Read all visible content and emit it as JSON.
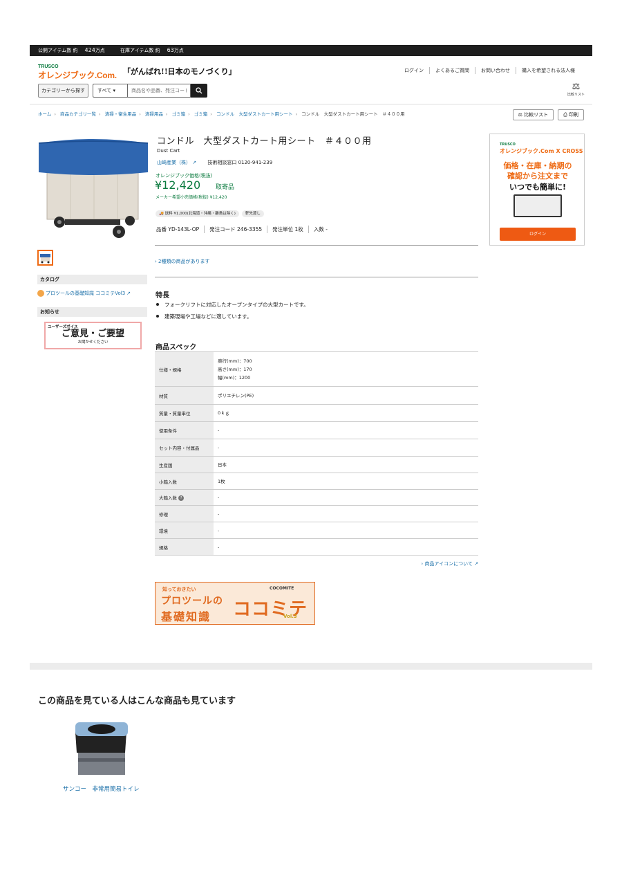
{
  "topbar": {
    "public_label": "公開アイテム数 約",
    "public_count": "424",
    "public_unit": "万点",
    "stock_label": "在庫アイテム数 約",
    "stock_count": "63",
    "stock_unit": "万点"
  },
  "header": {
    "logo_trusco": "TRUSCO",
    "logo_brand": "オレンジブック.Com.",
    "slogan": "「がんばれ!!日本のモノづくり」",
    "links": [
      "ログイン",
      "よくあるご質問",
      "お問い合わせ",
      "購入を希望される法人様"
    ],
    "category_button": "カテゴリーから探す",
    "search_scope": "すべて",
    "search_placeholder": "商品名や品番、発注コード",
    "compare_list": "比較リスト"
  },
  "breadcrumb": [
    "ホーム",
    "商品カテゴリ一覧",
    "清掃・衛生用品",
    "清掃用品",
    "ゴミ箱",
    "ゴミ箱",
    "コンドル　大型ダストカート用シート",
    "コンドル　大型ダストカート用シート　＃４００用"
  ],
  "toolbar": {
    "compare": "比較リスト",
    "print": "印刷"
  },
  "product": {
    "title": "コンドル　大型ダストカート用シート　＃４００用",
    "en_name": "Dust Cart",
    "maker": "山崎産業（株）",
    "support": "技術相談窓口  0120-941-239",
    "price_label": "オレンジブック価格(税抜)",
    "price": "¥12,420",
    "price_note": "取寄品",
    "msrp": "メーカー希望小売価格(税抜) ¥12,420",
    "tags": [
      "送料 ¥1,000(北海道・沖縄・離島は除く)",
      "軒先渡し"
    ],
    "codes": [
      "品番  YD-143L-OP",
      "発注コード  246-3355",
      "発注単位  1枚",
      "入数  -"
    ],
    "variants_link": "2種類の商品があります"
  },
  "sidebar": {
    "catalog_head": "カタログ",
    "catalog_link": "プロツールの基礎知識 ココミテVol3",
    "news_head": "お知らせ",
    "voice_small": "ユーザーズボイス",
    "voice_big": "ご意見・ご要望",
    "voice_sub": "お聞かせください"
  },
  "features": {
    "heading": "特長",
    "items": [
      "フォークリフトに対応したオープンタイプの大型カートです。",
      "建築現場や工場などに適しています。"
    ]
  },
  "spec": {
    "heading": "商品スペック",
    "rows": [
      {
        "k": "仕様・規格",
        "v": "奥行(mm)：700\n高さ(mm)：170\n幅(mm)：1200"
      },
      {
        "k": "材質",
        "v": "ポリエチレン(PE)"
      },
      {
        "k": "質量・質量単位",
        "v": "0ｋｇ"
      },
      {
        "k": "使用条件",
        "v": "-"
      },
      {
        "k": "セット内容・付属品",
        "v": "-"
      },
      {
        "k": "生産国",
        "v": "日本"
      },
      {
        "k": "小箱入数",
        "v": "1枚"
      },
      {
        "k": "大箱入数",
        "v": "-"
      },
      {
        "k": "修理",
        "v": "-"
      },
      {
        "k": "環境",
        "v": "-"
      },
      {
        "k": "規格",
        "v": "-"
      }
    ],
    "icon_about": "商品アイコンについて"
  },
  "banner": {
    "line1": "知っておきたい",
    "line2": "プロツールの",
    "line3": "基礎知識",
    "line4": "ココミテ",
    "brand": "COCOMITE",
    "vol": "Vol.3"
  },
  "ad": {
    "trusco": "TRUSCO",
    "brand": "オレンジブック.Com X CROSS",
    "line1": "価格・在庫・納期の",
    "line2": "確認から注文まで",
    "line3": "いつでも簡単に!",
    "button": "ログイン"
  },
  "recommend": {
    "title": "この商品を見ている人はこんな商品も見ています",
    "items": [
      {
        "name": "サンコー　非常用簡易トイレ"
      }
    ]
  }
}
